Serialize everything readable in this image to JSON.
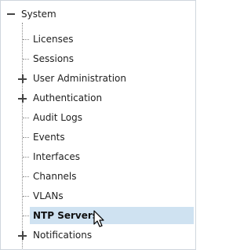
{
  "tree": {
    "root": {
      "label": "System",
      "expanded": true,
      "toggle_icon": "minus-icon"
    },
    "children": [
      {
        "label": "Licenses",
        "expandable": false
      },
      {
        "label": "Sessions",
        "expandable": false
      },
      {
        "label": "User Administration",
        "expandable": true,
        "toggle_icon": "plus-icon"
      },
      {
        "label": "Authentication",
        "expandable": true,
        "toggle_icon": "plus-icon"
      },
      {
        "label": "Audit Logs",
        "expandable": false
      },
      {
        "label": "Events",
        "expandable": false
      },
      {
        "label": "Interfaces",
        "expandable": false
      },
      {
        "label": "Channels",
        "expandable": false
      },
      {
        "label": "VLANs",
        "expandable": false
      },
      {
        "label": "NTP Servers",
        "expandable": false,
        "selected": true
      },
      {
        "label": "Notifications",
        "expandable": true,
        "toggle_icon": "plus-icon"
      }
    ]
  },
  "colors": {
    "selected_background": "#cfe2f1",
    "panel_border": "#cfd6dd",
    "tree_line": "#8a8a8a"
  },
  "cursor": {
    "icon": "mouse-pointer-icon"
  }
}
